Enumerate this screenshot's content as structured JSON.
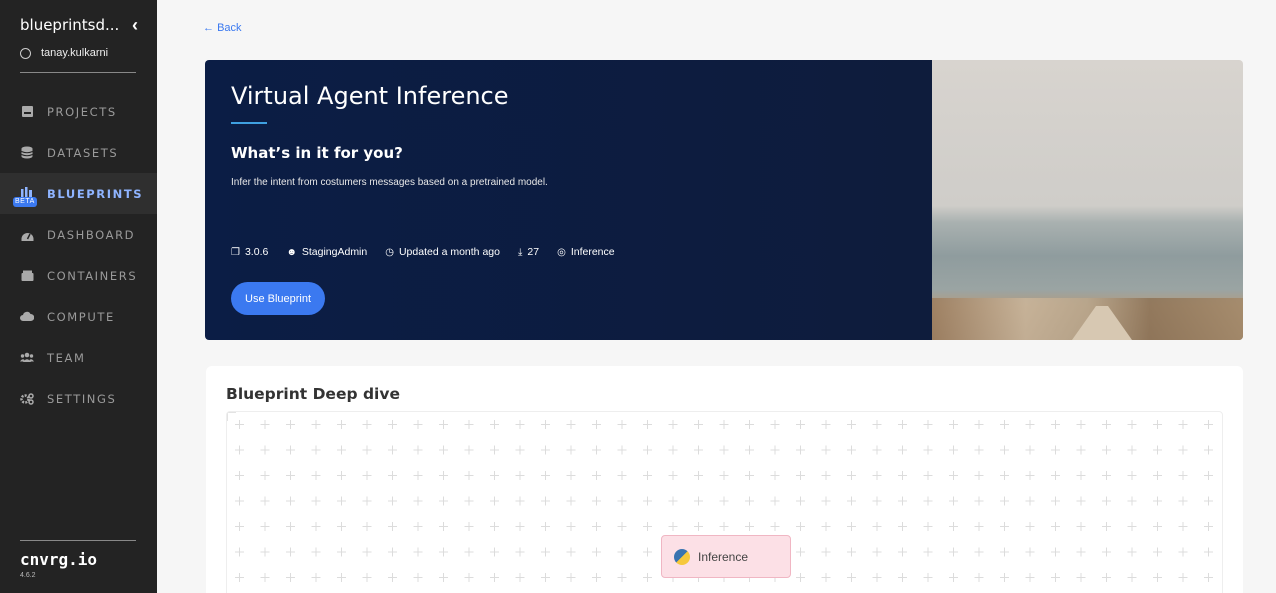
{
  "sidebar": {
    "workspace": "blueprintsd...",
    "username": "tanay.kulkarni",
    "items": [
      {
        "label": "PROJECTS",
        "icon": "projects-icon"
      },
      {
        "label": "DATASETS",
        "icon": "datasets-icon"
      },
      {
        "label": "BLUEPRINTS",
        "icon": "blueprints-icon",
        "badge": "BETA",
        "active": true
      },
      {
        "label": "DASHBOARD",
        "icon": "dashboard-icon"
      },
      {
        "label": "CONTAINERS",
        "icon": "containers-icon"
      },
      {
        "label": "COMPUTE",
        "icon": "compute-icon"
      },
      {
        "label": "TEAM",
        "icon": "team-icon"
      },
      {
        "label": "SETTINGS",
        "icon": "settings-icon"
      }
    ],
    "brand": "cnvrg.io",
    "version": "4.6.2"
  },
  "back_label": "Back",
  "hero": {
    "title": "Virtual Agent Inference",
    "subtitle": "What’s in it for you?",
    "description": "Infer the intent from costumers messages based on a pretrained model.",
    "meta": {
      "version": "3.0.6",
      "author": "StagingAdmin",
      "updated": "Updated a month ago",
      "downloads": "27",
      "category": "Inference"
    },
    "button_label": "Use Blueprint"
  },
  "deep_dive": {
    "title": "Blueprint Deep dive",
    "node_label": "Inference"
  },
  "colors": {
    "accent": "#3b79f0",
    "sidebar_bg": "#232323",
    "hero_bg": "#0b1d45",
    "node_bg": "#fce0e6"
  }
}
